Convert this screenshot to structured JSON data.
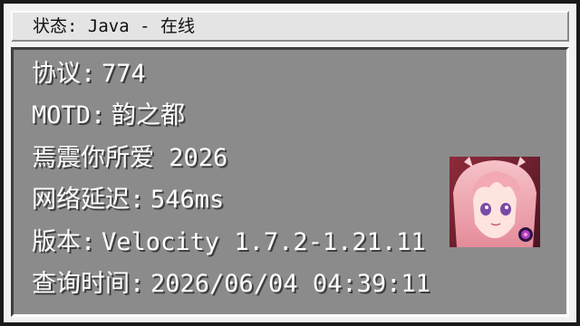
{
  "title_bar": {
    "label": "状态",
    "separator": ":",
    "value": "Java - 在线"
  },
  "lines": [
    {
      "label": "协议",
      "value": "774"
    },
    {
      "label": "MOTD",
      "value": "韵之都"
    },
    {
      "text": "焉震你所爱 2026"
    },
    {
      "label": "网络延迟",
      "value": "546ms"
    },
    {
      "label": "版本",
      "value": "Velocity 1.7.2-1.21.11"
    },
    {
      "label": "查询时间",
      "value": "2026/06/04 04:39:11"
    }
  ],
  "separator": ":",
  "avatar": {
    "icon": "server-icon-pink-hair-anime-character"
  }
}
